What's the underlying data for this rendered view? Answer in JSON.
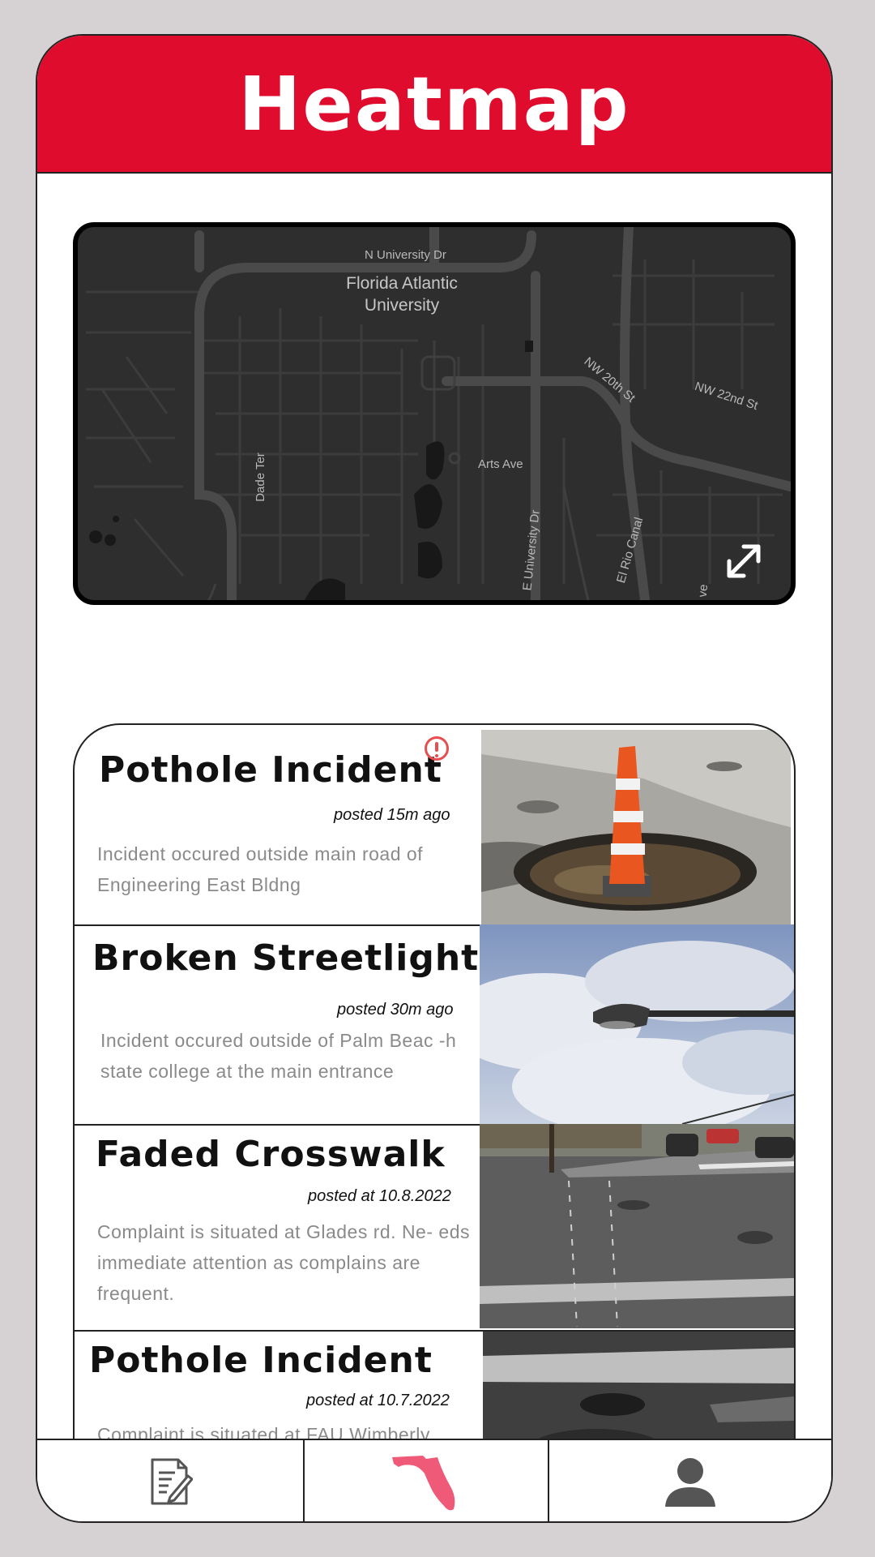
{
  "header": {
    "title": "Heatmap"
  },
  "map": {
    "labels": {
      "n_university_dr": "N University Dr",
      "campus": "Florida Atlantic\nUniversity",
      "nw_20th_st": "NW 20th St",
      "nw_22nd_st": "NW 22nd St",
      "dade_ter": "Dade Ter",
      "arts_ave": "Arts Ave",
      "e_university_dr": "E University Dr",
      "el_rio_canal": "El Rio Canal",
      "edge_text": "ve"
    },
    "expand_icon": "expand-arrows-icon"
  },
  "incidents": [
    {
      "title": "Pothole Incident",
      "posted": "posted 15m ago",
      "description": "Incident occured outside main road of Engineering East Bldng",
      "alert_icon": "exclamation-circle-icon",
      "photo": "pothole-with-traffic-cone-photo"
    },
    {
      "title": "Broken Streetlight",
      "posted": "posted 30m ago",
      "description": "Incident occured outside of Palm Beac -h state college at the main entrance",
      "photo": "streetlight-against-sky-photo"
    },
    {
      "title": "Faded Crosswalk",
      "posted": "posted at 10.8.2022",
      "description": "Complaint is situated at Glades rd. Ne- eds immediate attention as complains are frequent.",
      "photo": "faded-crosswalk-street-photo"
    },
    {
      "title": "Pothole Incident",
      "posted": "posted at 10.7.2022",
      "description": "Complaint is situated at FAU Wimberly",
      "photo": "pothole-crosswalk-photo"
    }
  ],
  "bottom_nav": {
    "tabs": [
      {
        "icon": "report-document-icon"
      },
      {
        "icon": "florida-map-icon",
        "active_color": "#ef5a78"
      },
      {
        "icon": "user-profile-icon"
      }
    ]
  },
  "colors": {
    "header": "#e00c2d",
    "map_bg": "#2e2e2e",
    "alert": "#e84e4e"
  }
}
